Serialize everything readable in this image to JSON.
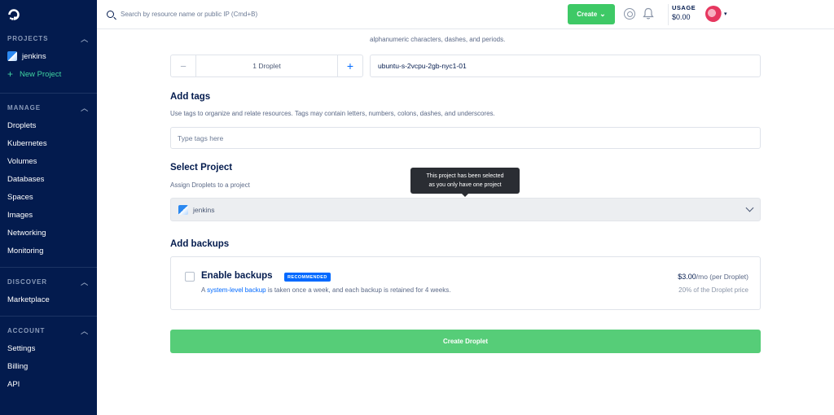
{
  "sidebar": {
    "sections": [
      {
        "title": "PROJECTS",
        "items": [
          {
            "label": "jenkins"
          },
          {
            "label": "New Project"
          }
        ]
      },
      {
        "title": "MANAGE",
        "items": [
          {
            "label": "Droplets"
          },
          {
            "label": "Kubernetes"
          },
          {
            "label": "Volumes"
          },
          {
            "label": "Databases"
          },
          {
            "label": "Spaces"
          },
          {
            "label": "Images"
          },
          {
            "label": "Networking"
          },
          {
            "label": "Monitoring"
          }
        ]
      },
      {
        "title": "DISCOVER",
        "items": [
          {
            "label": "Marketplace"
          }
        ]
      },
      {
        "title": "ACCOUNT",
        "items": [
          {
            "label": "Settings"
          },
          {
            "label": "Billing"
          },
          {
            "label": "API"
          }
        ]
      }
    ]
  },
  "topbar": {
    "search_placeholder": "Search by resource name or public IP (Cmd+B)",
    "create_label": "Create",
    "usage_label": "USAGE",
    "usage_value": "$0.00"
  },
  "hostname_section": {
    "partial_text": "alphanumeric characters, dashes, and periods.",
    "stepper_value": "1  Droplet",
    "hostname_value": "ubuntu-s-2vcpu-2gb-nyc1-01"
  },
  "tags": {
    "title": "Add tags",
    "description": "Use tags to organize and relate resources. Tags may contain letters, numbers, colons, dashes, and underscores.",
    "placeholder": "Type tags here"
  },
  "project": {
    "title": "Select Project",
    "description": "Assign Droplets to a project",
    "selected": "jenkins",
    "tooltip_line1": "This project has been selected",
    "tooltip_line2": "as you only have one project"
  },
  "backups": {
    "title": "Add backups",
    "option_title": "Enable backups",
    "badge": "RECOMMENDED",
    "desc_prefix": "A ",
    "desc_link": "system-level backup",
    "desc_suffix": " is taken once a week, and each backup is retained for 4 weeks.",
    "price_main": "$3.00",
    "price_unit": "/mo (per Droplet)",
    "price_sub": "20% of the Droplet price"
  },
  "submit": {
    "label": "Create Droplet"
  },
  "colors": {
    "sidebar_bg": "#031b4e",
    "accent_green": "#3ec966",
    "link_blue": "#0069ff",
    "new_project": "#3fd3a0"
  }
}
